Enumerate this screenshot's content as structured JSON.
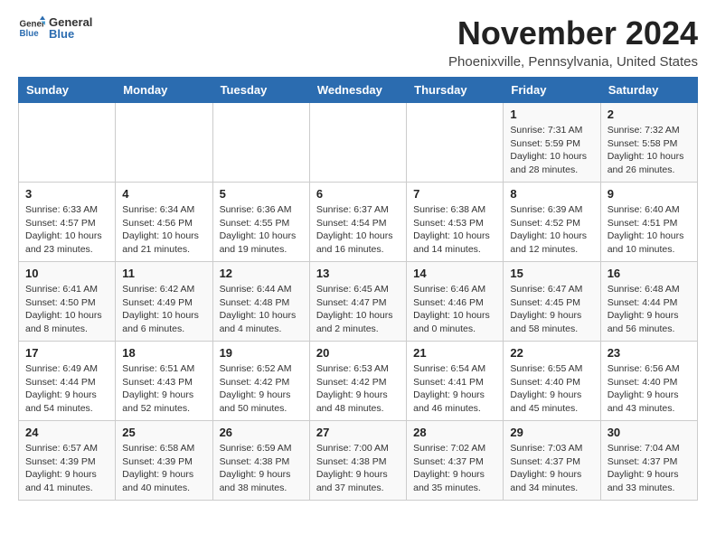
{
  "header": {
    "logo_general": "General",
    "logo_blue": "Blue",
    "title": "November 2024",
    "location": "Phoenixville, Pennsylvania, United States"
  },
  "days_of_week": [
    "Sunday",
    "Monday",
    "Tuesday",
    "Wednesday",
    "Thursday",
    "Friday",
    "Saturday"
  ],
  "weeks": [
    [
      {
        "day": "",
        "info": ""
      },
      {
        "day": "",
        "info": ""
      },
      {
        "day": "",
        "info": ""
      },
      {
        "day": "",
        "info": ""
      },
      {
        "day": "",
        "info": ""
      },
      {
        "day": "1",
        "info": "Sunrise: 7:31 AM\nSunset: 5:59 PM\nDaylight: 10 hours and 28 minutes."
      },
      {
        "day": "2",
        "info": "Sunrise: 7:32 AM\nSunset: 5:58 PM\nDaylight: 10 hours and 26 minutes."
      }
    ],
    [
      {
        "day": "3",
        "info": "Sunrise: 6:33 AM\nSunset: 4:57 PM\nDaylight: 10 hours and 23 minutes."
      },
      {
        "day": "4",
        "info": "Sunrise: 6:34 AM\nSunset: 4:56 PM\nDaylight: 10 hours and 21 minutes."
      },
      {
        "day": "5",
        "info": "Sunrise: 6:36 AM\nSunset: 4:55 PM\nDaylight: 10 hours and 19 minutes."
      },
      {
        "day": "6",
        "info": "Sunrise: 6:37 AM\nSunset: 4:54 PM\nDaylight: 10 hours and 16 minutes."
      },
      {
        "day": "7",
        "info": "Sunrise: 6:38 AM\nSunset: 4:53 PM\nDaylight: 10 hours and 14 minutes."
      },
      {
        "day": "8",
        "info": "Sunrise: 6:39 AM\nSunset: 4:52 PM\nDaylight: 10 hours and 12 minutes."
      },
      {
        "day": "9",
        "info": "Sunrise: 6:40 AM\nSunset: 4:51 PM\nDaylight: 10 hours and 10 minutes."
      }
    ],
    [
      {
        "day": "10",
        "info": "Sunrise: 6:41 AM\nSunset: 4:50 PM\nDaylight: 10 hours and 8 minutes."
      },
      {
        "day": "11",
        "info": "Sunrise: 6:42 AM\nSunset: 4:49 PM\nDaylight: 10 hours and 6 minutes."
      },
      {
        "day": "12",
        "info": "Sunrise: 6:44 AM\nSunset: 4:48 PM\nDaylight: 10 hours and 4 minutes."
      },
      {
        "day": "13",
        "info": "Sunrise: 6:45 AM\nSunset: 4:47 PM\nDaylight: 10 hours and 2 minutes."
      },
      {
        "day": "14",
        "info": "Sunrise: 6:46 AM\nSunset: 4:46 PM\nDaylight: 10 hours and 0 minutes."
      },
      {
        "day": "15",
        "info": "Sunrise: 6:47 AM\nSunset: 4:45 PM\nDaylight: 9 hours and 58 minutes."
      },
      {
        "day": "16",
        "info": "Sunrise: 6:48 AM\nSunset: 4:44 PM\nDaylight: 9 hours and 56 minutes."
      }
    ],
    [
      {
        "day": "17",
        "info": "Sunrise: 6:49 AM\nSunset: 4:44 PM\nDaylight: 9 hours and 54 minutes."
      },
      {
        "day": "18",
        "info": "Sunrise: 6:51 AM\nSunset: 4:43 PM\nDaylight: 9 hours and 52 minutes."
      },
      {
        "day": "19",
        "info": "Sunrise: 6:52 AM\nSunset: 4:42 PM\nDaylight: 9 hours and 50 minutes."
      },
      {
        "day": "20",
        "info": "Sunrise: 6:53 AM\nSunset: 4:42 PM\nDaylight: 9 hours and 48 minutes."
      },
      {
        "day": "21",
        "info": "Sunrise: 6:54 AM\nSunset: 4:41 PM\nDaylight: 9 hours and 46 minutes."
      },
      {
        "day": "22",
        "info": "Sunrise: 6:55 AM\nSunset: 4:40 PM\nDaylight: 9 hours and 45 minutes."
      },
      {
        "day": "23",
        "info": "Sunrise: 6:56 AM\nSunset: 4:40 PM\nDaylight: 9 hours and 43 minutes."
      }
    ],
    [
      {
        "day": "24",
        "info": "Sunrise: 6:57 AM\nSunset: 4:39 PM\nDaylight: 9 hours and 41 minutes."
      },
      {
        "day": "25",
        "info": "Sunrise: 6:58 AM\nSunset: 4:39 PM\nDaylight: 9 hours and 40 minutes."
      },
      {
        "day": "26",
        "info": "Sunrise: 6:59 AM\nSunset: 4:38 PM\nDaylight: 9 hours and 38 minutes."
      },
      {
        "day": "27",
        "info": "Sunrise: 7:00 AM\nSunset: 4:38 PM\nDaylight: 9 hours and 37 minutes."
      },
      {
        "day": "28",
        "info": "Sunrise: 7:02 AM\nSunset: 4:37 PM\nDaylight: 9 hours and 35 minutes."
      },
      {
        "day": "29",
        "info": "Sunrise: 7:03 AM\nSunset: 4:37 PM\nDaylight: 9 hours and 34 minutes."
      },
      {
        "day": "30",
        "info": "Sunrise: 7:04 AM\nSunset: 4:37 PM\nDaylight: 9 hours and 33 minutes."
      }
    ]
  ]
}
